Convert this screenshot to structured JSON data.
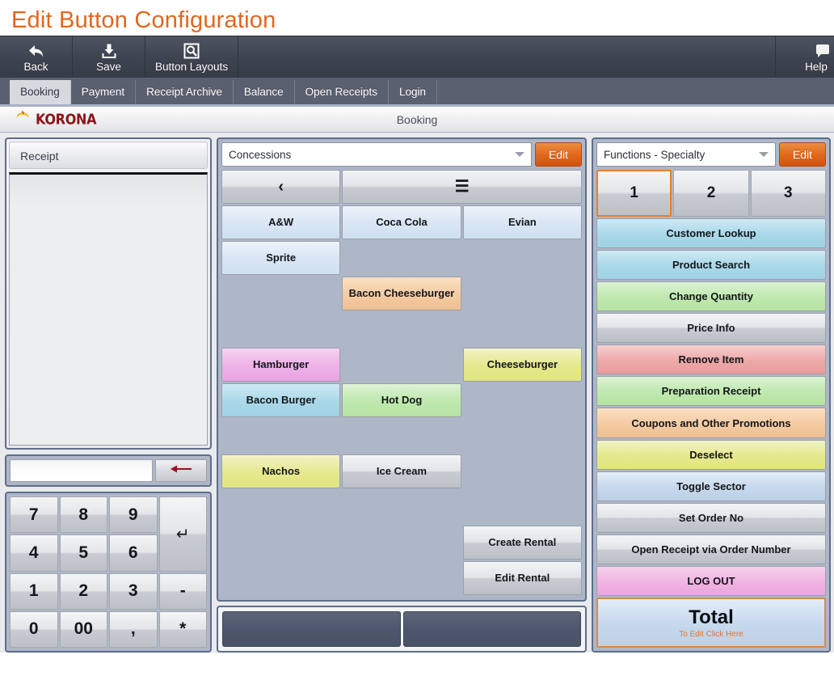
{
  "page": {
    "title": "Edit Button Configuration"
  },
  "toolbar": {
    "back": {
      "label": "Back",
      "icon": "back-arrow-icon"
    },
    "save": {
      "label": "Save",
      "icon": "save-icon"
    },
    "button_layouts": {
      "label": "Button Layouts",
      "icon": "magnifier-square-icon"
    },
    "help": {
      "label": "Help",
      "icon": "help-icon"
    }
  },
  "background_field": {
    "value": "",
    "placeholder": ""
  },
  "tabs": [
    {
      "label": "Booking",
      "active": true
    },
    {
      "label": "Payment",
      "active": false
    },
    {
      "label": "Receipt Archive",
      "active": false
    },
    {
      "label": "Balance",
      "active": false
    },
    {
      "label": "Open Receipts",
      "active": false
    },
    {
      "label": "Login",
      "active": false
    }
  ],
  "pos": {
    "brand": "KORONA",
    "header_title": "Booking",
    "receipt": {
      "title": "Receipt"
    },
    "entry": {
      "value": "",
      "backspace_icon": "backspace-arrow-icon"
    },
    "keypad": [
      {
        "label": "7"
      },
      {
        "label": "8"
      },
      {
        "label": "9"
      },
      {
        "label": "↵",
        "type": "enter"
      },
      {
        "label": "4"
      },
      {
        "label": "5"
      },
      {
        "label": "6"
      },
      {
        "label": "1"
      },
      {
        "label": "2"
      },
      {
        "label": "3"
      },
      {
        "label": "-"
      },
      {
        "label": "0"
      },
      {
        "label": "00"
      },
      {
        "label": ","
      },
      {
        "label": "*"
      }
    ],
    "product_panel": {
      "selector": {
        "value": "Concessions",
        "caret_icon": "chevron-down-icon"
      },
      "edit_label": "Edit",
      "nav": {
        "back_icon": "chevron-left-icon",
        "menu_icon": "hamburger-menu-icon"
      },
      "buttons": [
        {
          "label": "‹",
          "color": "gray",
          "kind": "nav",
          "span": 1
        },
        {
          "label": "☰",
          "color": "gray",
          "kind": "nav",
          "span": 2
        },
        {
          "label": "A&W",
          "color": "blue"
        },
        {
          "label": "Coca Cola",
          "color": "blue"
        },
        {
          "label": "Evian",
          "color": "blue"
        },
        {
          "label": "Sprite",
          "color": "blue"
        },
        {
          "label": "",
          "color": "empty"
        },
        {
          "label": "",
          "color": "empty"
        },
        {
          "label": "",
          "color": "empty"
        },
        {
          "label": "Bacon Cheeseburger",
          "color": "orange"
        },
        {
          "label": "",
          "color": "empty"
        },
        {
          "label": "",
          "color": "empty"
        },
        {
          "label": "",
          "color": "empty"
        },
        {
          "label": "",
          "color": "empty"
        },
        {
          "label": "Hamburger",
          "color": "magenta"
        },
        {
          "label": "",
          "color": "empty"
        },
        {
          "label": "Cheeseburger",
          "color": "yellow"
        },
        {
          "label": "Bacon Burger",
          "color": "cyan"
        },
        {
          "label": "Hot Dog",
          "color": "green"
        },
        {
          "label": "",
          "color": "empty"
        },
        {
          "label": "",
          "color": "empty"
        },
        {
          "label": "",
          "color": "empty"
        },
        {
          "label": "",
          "color": "empty"
        },
        {
          "label": "Nachos",
          "color": "yellow"
        },
        {
          "label": "Ice Cream",
          "color": "gray"
        },
        {
          "label": "",
          "color": "empty"
        },
        {
          "label": "",
          "color": "empty"
        },
        {
          "label": "",
          "color": "empty"
        },
        {
          "label": "",
          "color": "empty"
        },
        {
          "label": "",
          "color": "empty"
        },
        {
          "label": "",
          "color": "empty"
        },
        {
          "label": "Create Rental",
          "color": "gray"
        },
        {
          "label": "",
          "color": "empty"
        },
        {
          "label": "",
          "color": "empty"
        },
        {
          "label": "Edit Rental",
          "color": "gray"
        }
      ],
      "footer_slots": [
        {
          "label": ""
        },
        {
          "label": ""
        }
      ]
    },
    "function_panel": {
      "selector": {
        "value": "Functions - Specialty",
        "caret_icon": "chevron-down-icon"
      },
      "edit_label": "Edit",
      "pages": [
        {
          "label": "1",
          "selected": true
        },
        {
          "label": "2",
          "selected": false
        },
        {
          "label": "3",
          "selected": false
        }
      ],
      "functions": [
        {
          "label": "Customer Lookup",
          "color": "cyan"
        },
        {
          "label": "Product Search",
          "color": "cyan"
        },
        {
          "label": "Change Quantity",
          "color": "green"
        },
        {
          "label": "Price Info",
          "color": "gray"
        },
        {
          "label": "Remove Item",
          "color": "red"
        },
        {
          "label": "Preparation Receipt",
          "color": "green"
        },
        {
          "label": "Coupons and Other Promotions",
          "color": "orange"
        },
        {
          "label": "Deselect",
          "color": "yellow"
        },
        {
          "label": "Toggle Sector",
          "color": "lblue"
        },
        {
          "label": "Set Order No",
          "color": "gray"
        },
        {
          "label": "Open Receipt via Order Number",
          "color": "gray"
        },
        {
          "label": "LOG OUT",
          "color": "pink"
        }
      ],
      "total": {
        "label": "Total",
        "sub_label": "To Edit Click Here",
        "color": "lblue"
      }
    }
  },
  "colors": {
    "accent_orange": "#e2661c",
    "toolbar_bg": "#3e4350",
    "tabstrip_bg": "#5b6070",
    "panel_border": "#5e6d8c",
    "panel_bg": "#aeb7c8",
    "brand_red": "#8f1117"
  }
}
